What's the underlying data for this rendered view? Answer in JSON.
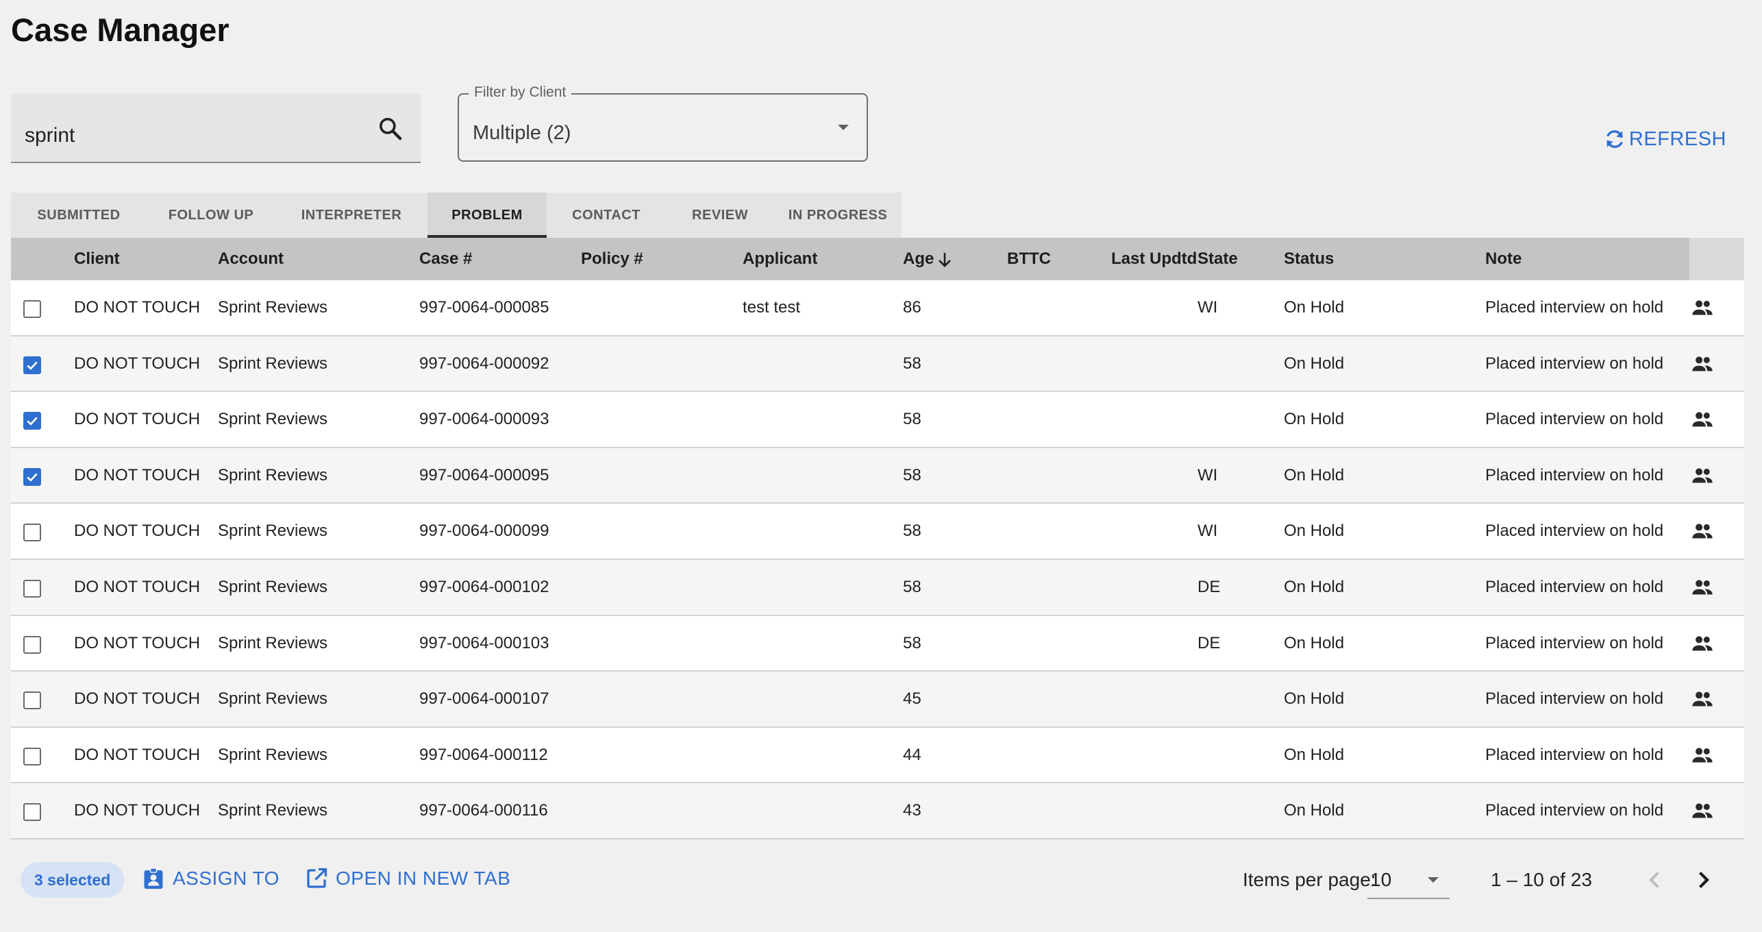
{
  "page": {
    "title": "Case Manager"
  },
  "search": {
    "value": "sprint"
  },
  "filter": {
    "label": "Filter by Client",
    "value": "Multiple (2)"
  },
  "refresh": {
    "label": "REFRESH"
  },
  "tabs": [
    {
      "label": "SUBMITTED",
      "active": false
    },
    {
      "label": "FOLLOW UP",
      "active": false
    },
    {
      "label": "INTERPRETER",
      "active": false
    },
    {
      "label": "PROBLEM",
      "active": true
    },
    {
      "label": "CONTACT",
      "active": false
    },
    {
      "label": "REVIEW",
      "active": false
    },
    {
      "label": "IN PROGRESS",
      "active": false
    }
  ],
  "table": {
    "columns": {
      "client": "Client",
      "account": "Account",
      "case": "Case #",
      "policy": "Policy #",
      "applicant": "Applicant",
      "age": "Age",
      "bttc": "BTTC",
      "last_updated": "Last Updtd",
      "state": "State",
      "status": "Status",
      "note": "Note"
    },
    "sort": {
      "column": "Age",
      "direction": "descending"
    },
    "rows": [
      {
        "checked": false,
        "client": "DO NOT TOUCH",
        "account": "Sprint Reviews",
        "case": "997-0064-000085",
        "policy": "",
        "applicant": "test test",
        "age": "86",
        "bttc": "",
        "last_updated": "",
        "state": "WI",
        "status": "On Hold",
        "note": "Placed interview on hold"
      },
      {
        "checked": true,
        "client": "DO NOT TOUCH",
        "account": "Sprint Reviews",
        "case": "997-0064-000092",
        "policy": "",
        "applicant": "",
        "age": "58",
        "bttc": "",
        "last_updated": "",
        "state": "",
        "status": "On Hold",
        "note": "Placed interview on hold"
      },
      {
        "checked": true,
        "client": "DO NOT TOUCH",
        "account": "Sprint Reviews",
        "case": "997-0064-000093",
        "policy": "",
        "applicant": "",
        "age": "58",
        "bttc": "",
        "last_updated": "",
        "state": "",
        "status": "On Hold",
        "note": "Placed interview on hold"
      },
      {
        "checked": true,
        "client": "DO NOT TOUCH",
        "account": "Sprint Reviews",
        "case": "997-0064-000095",
        "policy": "",
        "applicant": "",
        "age": "58",
        "bttc": "",
        "last_updated": "",
        "state": "WI",
        "status": "On Hold",
        "note": "Placed interview on hold"
      },
      {
        "checked": false,
        "client": "DO NOT TOUCH",
        "account": "Sprint Reviews",
        "case": "997-0064-000099",
        "policy": "",
        "applicant": "",
        "age": "58",
        "bttc": "",
        "last_updated": "",
        "state": "WI",
        "status": "On Hold",
        "note": "Placed interview on hold"
      },
      {
        "checked": false,
        "client": "DO NOT TOUCH",
        "account": "Sprint Reviews",
        "case": "997-0064-000102",
        "policy": "",
        "applicant": "",
        "age": "58",
        "bttc": "",
        "last_updated": "",
        "state": "DE",
        "status": "On Hold",
        "note": "Placed interview on hold"
      },
      {
        "checked": false,
        "client": "DO NOT TOUCH",
        "account": "Sprint Reviews",
        "case": "997-0064-000103",
        "policy": "",
        "applicant": "",
        "age": "58",
        "bttc": "",
        "last_updated": "",
        "state": "DE",
        "status": "On Hold",
        "note": "Placed interview on hold"
      },
      {
        "checked": false,
        "client": "DO NOT TOUCH",
        "account": "Sprint Reviews",
        "case": "997-0064-000107",
        "policy": "",
        "applicant": "",
        "age": "45",
        "bttc": "",
        "last_updated": "",
        "state": "",
        "status": "On Hold",
        "note": "Placed interview on hold"
      },
      {
        "checked": false,
        "client": "DO NOT TOUCH",
        "account": "Sprint Reviews",
        "case": "997-0064-000112",
        "policy": "",
        "applicant": "",
        "age": "44",
        "bttc": "",
        "last_updated": "",
        "state": "",
        "status": "On Hold",
        "note": "Placed interview on hold"
      },
      {
        "checked": false,
        "client": "DO NOT TOUCH",
        "account": "Sprint Reviews",
        "case": "997-0064-000116",
        "policy": "",
        "applicant": "",
        "age": "43",
        "bttc": "",
        "last_updated": "",
        "state": "",
        "status": "On Hold",
        "note": "Placed interview on hold"
      }
    ]
  },
  "footer": {
    "selected_label": "3 selected",
    "assign_label": "ASSIGN TO",
    "open_tab_label": "OPEN IN NEW TAB",
    "items_per_page_label": "Items per page:",
    "items_per_page_value": "10",
    "range_label": "1 – 10 of 23"
  },
  "colors": {
    "accent": "#2f6fd0",
    "header_bg": "#c4c4c4",
    "chip_bg": "#d6e2f5",
    "page_bg": "#f0f0f0"
  },
  "icons": {
    "search": "search-icon",
    "dropdown": "chevron-down-icon",
    "refresh": "refresh-icon",
    "sort": "arrow-down-icon",
    "row_action": "people-icon",
    "assign": "assignment-ind-icon",
    "open_tab": "open-in-new-icon",
    "prev": "chevron-left-icon",
    "next": "chevron-right-icon"
  }
}
